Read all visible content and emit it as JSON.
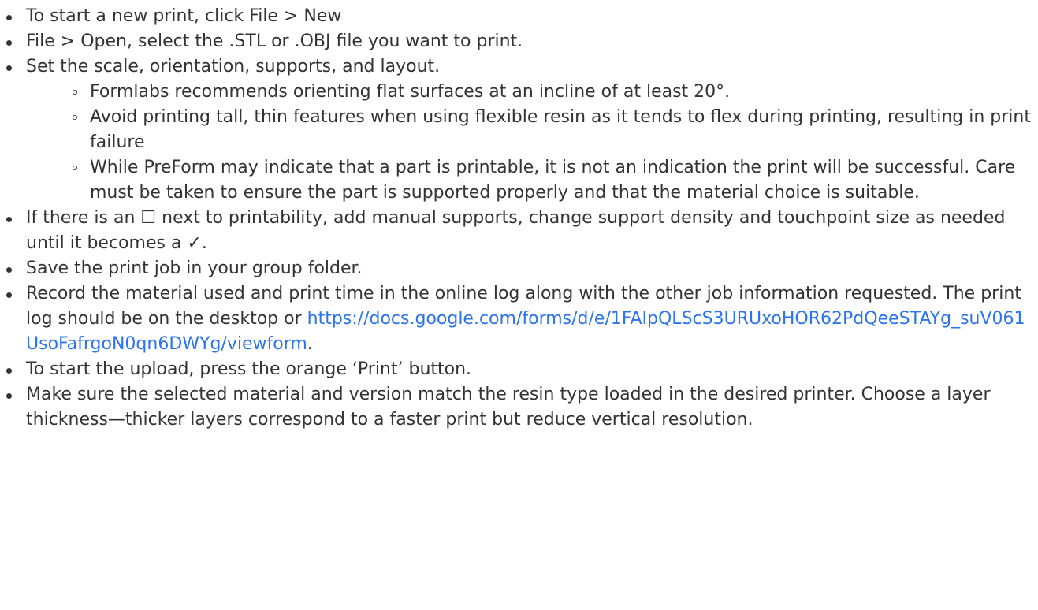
{
  "colors": {
    "text": "#333333",
    "link": "#2b73f0",
    "background": "#ffffff"
  },
  "steps": {
    "new_print": "To start a new print, click File > New",
    "open_file": "File > Open, select the .STL or .OBJ file you want to print.",
    "set_scale": "Set the scale, orientation, supports, and layout.",
    "sub": {
      "orient": "Formlabs recommends orienting flat surfaces at an incline of at least 20°.",
      "avoid_tall": "Avoid printing tall, thin features when using flexible resin as it tends to flex during printing, resulting in print failure",
      "preform_note": "While PreForm may indicate that a part is printable, it is not an indication the print will be successful. Care must be taken to ensure the part is supported properly and that the material choice is suitable."
    },
    "printability": "If there is an ☐ next to printability, add manual supports, change support density and touchpoint size as needed until it becomes a ✓.",
    "save_job": "Save the print job in your group folder.",
    "record_prefix": "Record the material used and print time in the online log along with the other job information requested. The print log should be on the desktop or ",
    "record_link": "https://docs.google.com/forms/d/e/1FAIpQLScS3URUxoHOR62PdQeeSTAYg_suV061UsoFafrgoN0qn6DWYg/viewform",
    "record_suffix": ".",
    "start_upload": "To start the upload, press the orange ‘Print’ button.",
    "material_match": "Make sure the selected material and version match the resin type loaded in the desired printer. Choose a layer thickness—thicker layers correspond to a faster print but reduce vertical resolution."
  }
}
